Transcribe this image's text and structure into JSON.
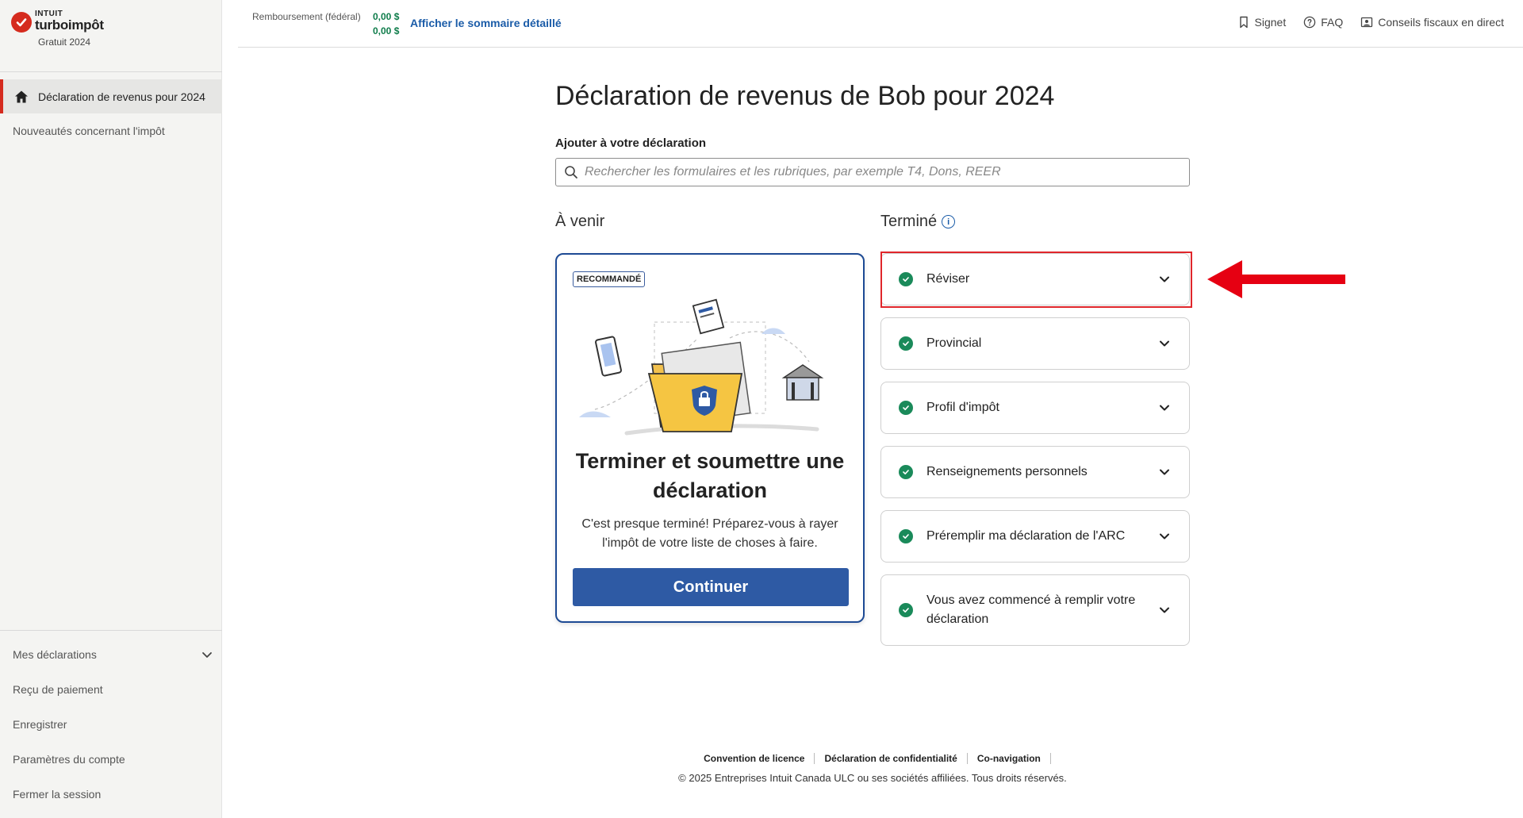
{
  "brand": {
    "intuit": "INTUIT",
    "product": "turboimpôt",
    "edition": "Gratuit 2024",
    "accent": "#d52b1e"
  },
  "sidebar": {
    "active_item": "Déclaration de revenus pour 2024",
    "top_items": [
      "Nouveautés concernant l'impôt"
    ],
    "bottom_items": [
      "Mes déclarations",
      "Reçu de paiement",
      "Enregistrer",
      "Paramètres du compte",
      "Fermer la session"
    ]
  },
  "header": {
    "refund_label": "Remboursement (fédéral)",
    "refund_amount_1": "0,00  $",
    "refund_amount_2": "0,00  $",
    "summary_link": "Afficher le sommaire détaillé",
    "bookmark": "Signet",
    "faq": "FAQ",
    "live_tax_advice": "Conseils fiscaux en direct"
  },
  "main": {
    "title": "Déclaration de revenus de Bob pour 2024",
    "add_label": "Ajouter à votre déclaration",
    "search_placeholder": "Rechercher les formulaires et les rubriques, par exemple T4, Dons, REER",
    "upcoming_heading": "À venir",
    "done_heading": "Terminé",
    "card": {
      "badge": "RECOMMANDÉ",
      "title": "Terminer et soumettre une déclaration",
      "description": "C'est presque terminé! Préparez-vous à rayer l'impôt de votre liste de choses à faire.",
      "button": "Continuer"
    },
    "done_items": [
      "Réviser",
      "Provincial",
      "Profil d'impôt",
      "Renseignements personnels",
      "Préremplir ma déclaration de l'ARC",
      "Vous avez commencé à remplir votre déclaration"
    ]
  },
  "footer": {
    "links": [
      "Convention de licence",
      "Déclaration de confidentialité",
      "Co-navigation"
    ],
    "copyright": "© 2025 Entreprises Intuit Canada ULC ou ses sociétés affiliées. Tous droits réservés."
  }
}
